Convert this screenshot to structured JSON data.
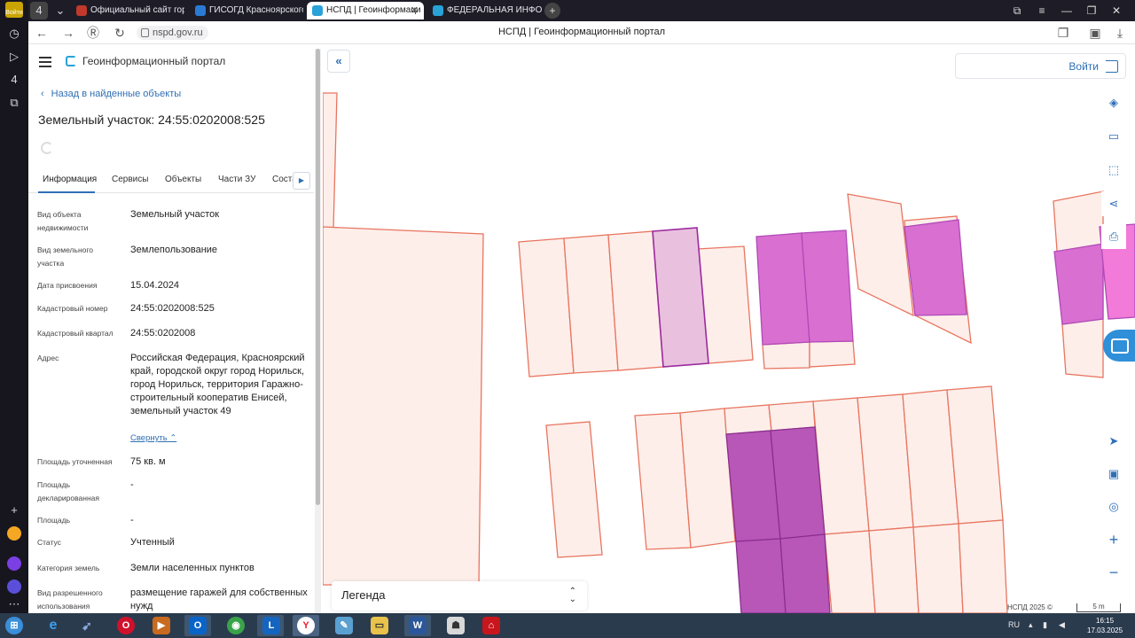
{
  "browser": {
    "profile_label": "Войти",
    "tabs": [
      {
        "title": "Официальный сайт город",
        "color": "#c0392b"
      },
      {
        "title": "ГИСОГД Красноярского к",
        "color": "#2a7ad4"
      },
      {
        "title": "НСПД | Геоинформаци",
        "color": "#28a2d8",
        "active": true
      },
      {
        "title": "ФЕДЕРАЛЬНАЯ ИНФОРМ",
        "color": "#28a2d8"
      }
    ],
    "url": "nspd.gov.ru",
    "page_title": "НСПД | Геоинформационный портал"
  },
  "panel": {
    "portal_name": "Геоинформационный портал",
    "back_link": "Назад в найденные объекты",
    "object_title": "Земельный участок: 24:55:0202008:525",
    "tabs": [
      "Информация",
      "Сервисы",
      "Объекты",
      "Части ЗУ",
      "Соста"
    ],
    "fields": [
      {
        "label": "Вид объекта недвижимости",
        "value": "Земельный участок"
      },
      {
        "label": "Вид земельного участка",
        "value": "Землепользование"
      },
      {
        "label": "Дата присвоения",
        "value": "15.04.2024"
      },
      {
        "label": "Кадастровый номер",
        "value": "24:55:0202008:525"
      },
      {
        "label": "Кадастровый квартал",
        "value": "24:55:0202008"
      },
      {
        "label": "Адрес",
        "value": "Российская Федерация, Красноярский край, городской округ город Норильск, город Норильск, территория Гаражно-строительный кооператив Енисей, земельный участок 49"
      },
      {
        "label": "Площадь уточненная",
        "value": "75 кв. м"
      },
      {
        "label": "Площадь декларированная",
        "value": "-"
      },
      {
        "label": "Площадь",
        "value": "-"
      },
      {
        "label": "Статус",
        "value": "Учтенный"
      },
      {
        "label": "Категория земель",
        "value": "Земли населенных пунктов"
      },
      {
        "label": "Вид разрешенного использования",
        "value": "размещение гаражей для собственных нужд"
      }
    ],
    "collapse_link": "Свернуть"
  },
  "map": {
    "login_label": "Войти",
    "legend_label": "Легенда",
    "copyright": "НСПД 2025 ©",
    "scale_label": "5 m",
    "tools": [
      "layers-icon",
      "ruler-icon",
      "select-area-icon",
      "share-icon",
      "print-icon"
    ],
    "tools_bottom": [
      "locate-icon",
      "minimap-icon",
      "geolocation-icon",
      "zoom-in-icon",
      "zoom-out-icon"
    ],
    "colors": {
      "parcel_fill": "#fdeeea",
      "parcel_stroke": "#e8755f",
      "selected_fill": "#e9c1de",
      "selected_stroke": "#9c2a9e",
      "highlight_fill": "#d96fd0",
      "highlight_dark": "#b857b8"
    }
  },
  "taskbar": {
    "language": "RU",
    "time": "16:15",
    "date": "17.03.2025"
  }
}
